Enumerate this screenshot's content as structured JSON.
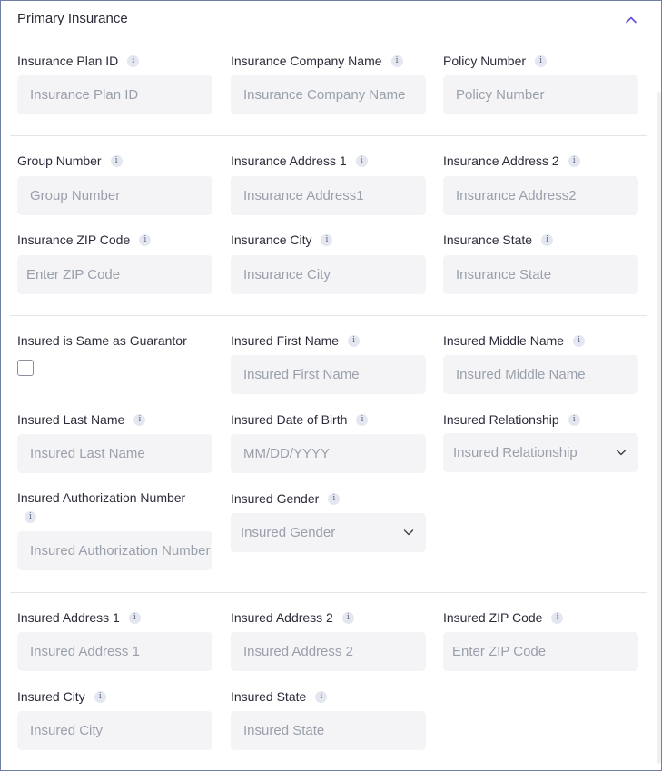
{
  "panel": {
    "title": "Primary Insurance"
  },
  "fields": {
    "plan_id": {
      "label": "Insurance Plan ID",
      "placeholder": "Insurance Plan ID"
    },
    "company_name": {
      "label": "Insurance Company Name",
      "placeholder": "Insurance Company Name"
    },
    "policy_number": {
      "label": "Policy Number",
      "placeholder": "Policy Number"
    },
    "group_number": {
      "label": "Group Number",
      "placeholder": "Group Number"
    },
    "ins_address1": {
      "label": "Insurance Address 1",
      "placeholder": "Insurance Address1"
    },
    "ins_address2": {
      "label": "Insurance Address 2",
      "placeholder": "Insurance Address2"
    },
    "ins_zip": {
      "label": "Insurance ZIP Code",
      "placeholder": "Enter ZIP Code"
    },
    "ins_city": {
      "label": "Insurance City",
      "placeholder": "Insurance City"
    },
    "ins_state": {
      "label": "Insurance State",
      "placeholder": "Insurance State"
    },
    "same_as_guarantor": {
      "label": "Insured is Same as Guarantor",
      "checked": false
    },
    "insured_first": {
      "label": "Insured First Name",
      "placeholder": "Insured First Name"
    },
    "insured_middle": {
      "label": "Insured Middle Name",
      "placeholder": "Insured Middle Name"
    },
    "insured_last": {
      "label": "Insured Last Name",
      "placeholder": "Insured Last Name"
    },
    "insured_dob": {
      "label": "Insured Date of Birth",
      "placeholder": "MM/DD/YYYY"
    },
    "insured_relationship": {
      "label": "Insured Relationship",
      "placeholder": "Insured Relationship"
    },
    "insured_auth": {
      "label": "Insured Authorization Number",
      "placeholder": "Insured Authorization Number"
    },
    "insured_gender": {
      "label": "Insured Gender",
      "placeholder": "Insured Gender"
    },
    "insured_address1": {
      "label": "Insured Address 1",
      "placeholder": "Insured Address 1"
    },
    "insured_address2": {
      "label": "Insured Address 2",
      "placeholder": "Insured Address 2"
    },
    "insured_zip": {
      "label": "Insured ZIP Code",
      "placeholder": "Enter ZIP Code"
    },
    "insured_city": {
      "label": "Insured City",
      "placeholder": "Insured City"
    },
    "insured_state": {
      "label": "Insured State",
      "placeholder": "Insured State"
    }
  },
  "info_glyph": "i",
  "colors": {
    "accent": "#6b4fd8",
    "input_bg": "#f4f4f6",
    "placeholder": "#9aa0ab",
    "border": "#6e7fa3"
  }
}
